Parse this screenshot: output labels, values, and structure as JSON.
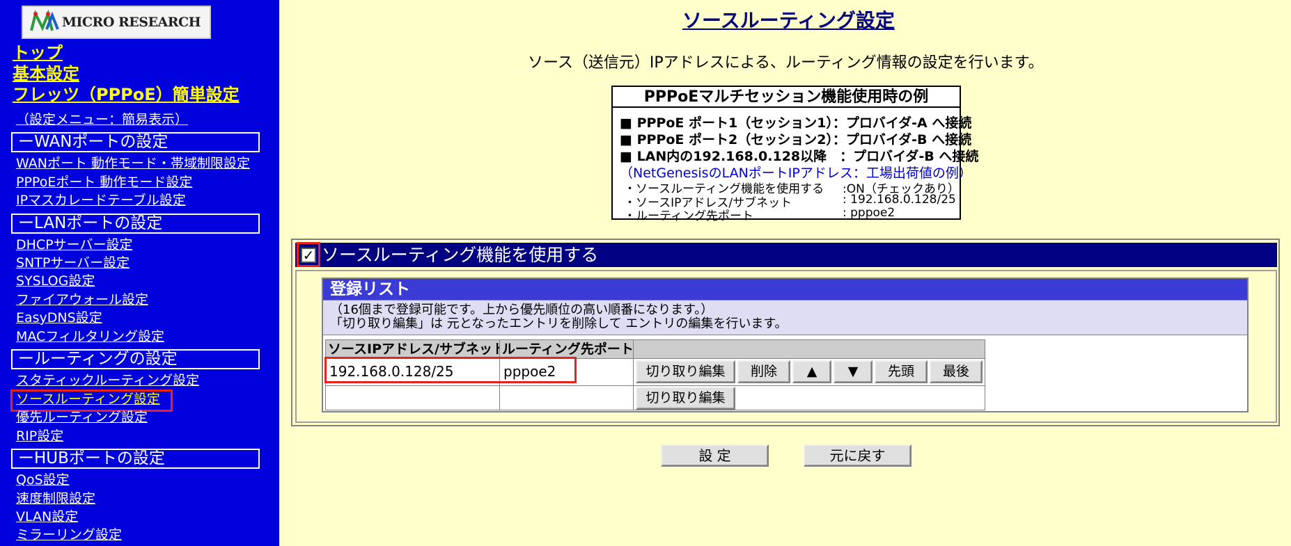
{
  "brand": {
    "logo_text": "MICRO RESEARCH"
  },
  "nav": {
    "top_links": [
      "トップ",
      "基本設定",
      "フレッツ（PPPoE）簡単設定"
    ],
    "menu_mode": "（設定メニュー：簡易表示）",
    "sections": [
      {
        "title": "ーWANポートの設定",
        "items": [
          "WANポート 動作モード・帯域制限設定",
          "PPPoEポート 動作モード設定",
          "IPマスカレードテーブル設定"
        ]
      },
      {
        "title": "ーLANポートの設定",
        "items": [
          "DHCPサーバー設定",
          "SNTPサーバー設定",
          "SYSLOG設定",
          "ファイアウォール設定",
          "EasyDNS設定",
          "MACフィルタリング設定"
        ]
      },
      {
        "title": "ールーティングの設定",
        "items": [
          "スタティックルーティング設定",
          "ソースルーティング設定",
          "優先ルーティング設定",
          "RIP設定"
        ]
      },
      {
        "title": "ーHUBポートの設定",
        "items": [
          "QoS設定",
          "速度制限設定",
          "VLAN設定",
          "ミラーリング設定"
        ]
      }
    ]
  },
  "main": {
    "title": "ソースルーティング設定",
    "description": "ソース（送信元）IPアドレスによる、ルーティング情報の設定を行います。",
    "example": {
      "title": "PPPoEマルチセッション機能使用時の例",
      "lines": [
        "■ PPPoE ポート1（セッション1）：プロバイダ-A へ接続",
        "■ PPPoE ポート2（セッション2）：プロバイダ-B へ接続",
        "■ LAN内の192.168.0.128以降　：プロバイダ-B へ接続"
      ],
      "note": "（NetGenesisのLANポートIPアドレス：工場出荷値の例）",
      "settings": [
        {
          "label": "・ソースルーティング機能を使用する",
          "value": ":ON（チェックあり）"
        },
        {
          "label": "・ソースIPアドレス/サブネット",
          "value": ": 192.168.0.128/25"
        },
        {
          "label": "・ルーティング先ポート",
          "value": ": pppoe2"
        }
      ]
    },
    "feature": {
      "label": "ソースルーティング機能を使用する",
      "checked": true,
      "check_mark": "✓"
    },
    "list": {
      "title": "登録リスト",
      "note_lines": [
        "（16個まで登録可能です。上から優先順位の高い順番になります。）",
        "「切り取り編集」は 元となったエントリを削除して エントリの編集を行います。"
      ],
      "headers": [
        "ソースIPアドレス/サブネット",
        "ルーティング先ポート"
      ],
      "rows": [
        {
          "ip": "192.168.0.128/25",
          "port": "pppoe2"
        },
        {
          "ip": "",
          "port": ""
        }
      ],
      "row_buttons": [
        "切り取り編集",
        "削除",
        "▲",
        "▼",
        "先頭",
        "最後"
      ],
      "empty_row_button": "切り取り編集"
    },
    "submit_label": "設 定",
    "reset_label": "元に戻す"
  },
  "colors": {
    "sidebar_bg": "#0000dd",
    "page_bg": "#ffffcc",
    "title_bar": "#000080",
    "list_title": "#3b3bd6",
    "highlight": "#e8221e",
    "nav_active": "#ffff00"
  }
}
